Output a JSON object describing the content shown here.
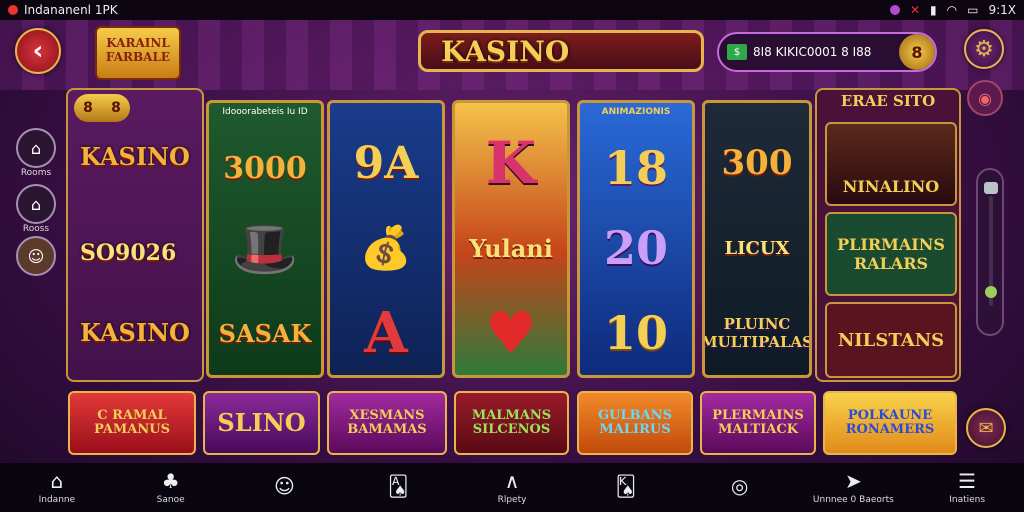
{
  "status_bar": {
    "app_name": "Indananenl 1PK",
    "time": "9:1X",
    "icons": [
      "notification-icon",
      "signal-icon",
      "wifi-icon",
      "battery-icon"
    ]
  },
  "header": {
    "logo_text": "KARAINL FARBALE",
    "title": "KASINO",
    "balance": "8I8 KIKIC0001 8 I88",
    "coin_label": "8"
  },
  "left_sidebar": [
    {
      "label": "Rooms",
      "icon": "lobby-icon"
    },
    {
      "label": "Rooss",
      "icon": "home-icon"
    },
    {
      "label": "",
      "icon": "avatar-icon"
    }
  ],
  "left_panel": {
    "badge": [
      "8",
      "8"
    ],
    "lines": [
      "KASINO",
      "SO9026",
      "KASINO"
    ]
  },
  "reels": [
    {
      "header": "Idooorabeteis Iu ID",
      "symbols": [
        "3000",
        "",
        "SASAK"
      ]
    },
    {
      "header": "",
      "symbols": [
        "9A",
        "",
        "A"
      ]
    },
    {
      "header": "",
      "symbols": [
        "K",
        "Yulani",
        "♥"
      ]
    },
    {
      "header": "ANIMAZIONIS",
      "symbols": [
        "18",
        "20",
        "10"
      ]
    },
    {
      "header": "",
      "symbols": [
        "300",
        "LICUX",
        "PLUINC MULTIPALAS"
      ]
    }
  ],
  "right_panel": {
    "header": "ERAE SITO",
    "tiles": [
      "NINALINO",
      "PLIRMAINS RALARS",
      "NILSTANS"
    ]
  },
  "games": [
    {
      "label": "C RAMAL PAMANUS"
    },
    {
      "label": "SLINO"
    },
    {
      "label": "XESMANS BAMAMAS"
    },
    {
      "label": "MALMANS SILCENOS"
    },
    {
      "label": "GULBANS MALIRUS"
    },
    {
      "label": "PLERMAINS MALTIACK"
    },
    {
      "label": "POLKAUNE RONAMERS"
    }
  ],
  "bottom_nav": [
    {
      "label": "Indanne",
      "icon": "home-icon"
    },
    {
      "label": "Sanoe",
      "icon": "games-icon"
    },
    {
      "label": "",
      "icon": "emoji-icon"
    },
    {
      "label": "",
      "icon": "cards-icon"
    },
    {
      "label": "Rlpety",
      "icon": "slots-icon"
    },
    {
      "label": "",
      "icon": "card-icon"
    },
    {
      "label": "",
      "icon": "search-icon"
    },
    {
      "label": "Unnnee 0 Baeorts",
      "icon": "share-icon"
    },
    {
      "label": "Inatiens",
      "icon": "menu-icon"
    }
  ],
  "colors": {
    "accent": "#e7b64a",
    "background": "#3a0f45",
    "reel_green": "#1f5a2e",
    "reel_blue": "#1a3c8c"
  }
}
